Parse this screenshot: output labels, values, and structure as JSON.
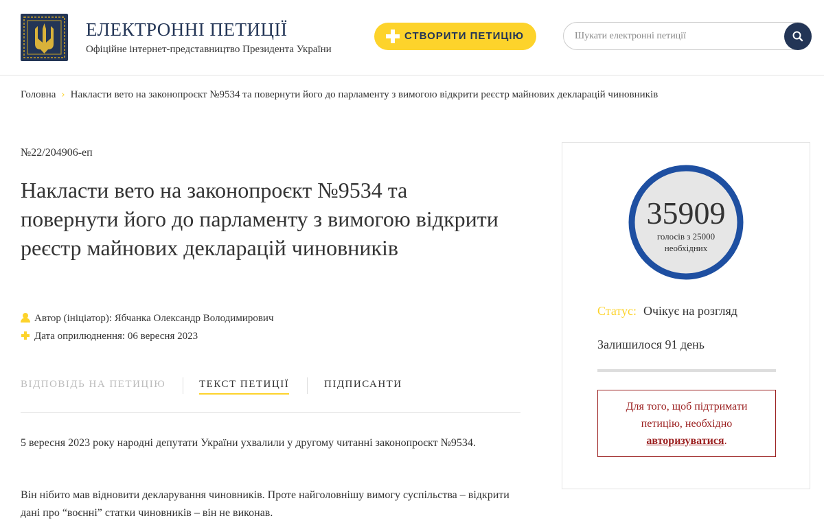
{
  "header": {
    "site_title": "ЕЛЕКТРОННІ ПЕТИЦІЇ",
    "site_subtitle": "Офіційне інтернет-представництво Президента України",
    "create_button": "СТВОРИТИ ПЕТИЦІЮ",
    "search_placeholder": "Шукати електронні петиції",
    "logo_icon": "trident-emblem-icon",
    "colors": {
      "brand": "#233556",
      "accent": "#fdd32b",
      "alert": "#9b2020"
    }
  },
  "breadcrumb": {
    "home": "Головна",
    "separator": "›",
    "current": "Накласти вето на законопроєкт №9534 та повернути його до парламенту з вимогою відкрити реєстр майнових декларацій чиновників"
  },
  "petition": {
    "number": "№22/204906-еп",
    "title": "Накласти вето на законопроєкт №9534 та повернути його до парламенту з вимогою відкрити реєстр майнових декларацій чиновників",
    "author": "Автор (ініціатор): Ябчанка Олександр Володимирович",
    "published": "Дата оприлюднення: 06 вересня 2023"
  },
  "tabs": [
    {
      "label": "ВІДПОВІДЬ НА ПЕТИЦІЮ",
      "state": "disabled"
    },
    {
      "label": "ТЕКСТ ПЕТИЦІЇ",
      "state": "active"
    },
    {
      "label": "ПІДПИСАНТИ",
      "state": "normal"
    }
  ],
  "body": {
    "paragraph1": "5 вересня 2023 року народні депутати України ухвалили у другому читанні законопроєкт №9534.",
    "paragraph2": "Він нібито мав відновити декларування чиновників. Проте найголовнішу вимогу суспільства – відкрити дані про “воєнні” статки чиновників – він не виконав."
  },
  "sidebar": {
    "votes": "35909",
    "votes_caption_line1": "голосів з 25000",
    "votes_caption_line2": "необхідних",
    "status_label": "Статус:",
    "status_value": "Очікує на розгляд",
    "remaining": "Залишилося 91 день",
    "auth_text_before": "Для того, щоб підтримати петицію, необхідно",
    "auth_link": "авторизуватися",
    "auth_text_after": "."
  }
}
